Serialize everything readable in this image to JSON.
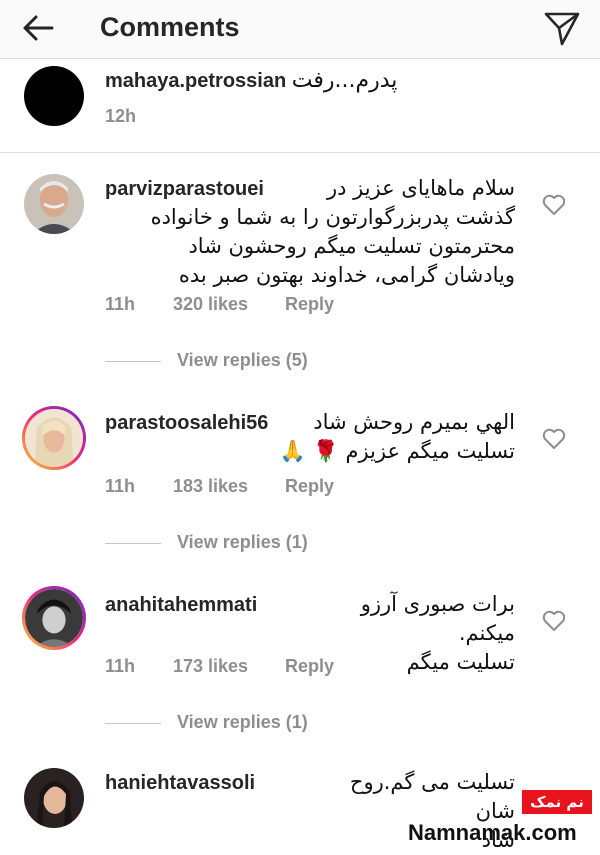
{
  "header": {
    "title": "Comments"
  },
  "comments": [
    {
      "username": "mahaya.petrossian",
      "text": "پدرم...رفت",
      "time": "12h"
    },
    {
      "username": "parvizparastouei",
      "lines": [
        "سلام ماهایای عزیز در",
        "گذشت پدربزرگوارتون  را به شما و خانواده",
        "محترمتون تسلیت میگم روحشون شاد",
        "ویادشان گرامی، خداوند بهتون صبر بده"
      ],
      "time": "11h",
      "likes": "320 likes",
      "reply": "Reply",
      "view_replies": "View replies (5)"
    },
    {
      "username": "parastoosalehi56",
      "lines": [
        "الهي بميرم روحش شاد",
        "تسليت ميگم عزيزم 🌹 🙏"
      ],
      "time": "11h",
      "likes": "183 likes",
      "reply": "Reply",
      "view_replies": "View replies (1)"
    },
    {
      "username": "anahitahemmati",
      "lines": [
        "برات صبوری آرزو میکنم.",
        "تسلیت میگم"
      ],
      "time": "11h",
      "likes": "173 likes",
      "reply": "Reply",
      "view_replies": "View replies (1)"
    },
    {
      "username": "haniehtavassoli",
      "lines": [
        "تسلیت می گم.روح شان",
        "شاد"
      ]
    }
  ],
  "watermark": {
    "badge": "نم نمک",
    "site": "Namnamak.com"
  }
}
